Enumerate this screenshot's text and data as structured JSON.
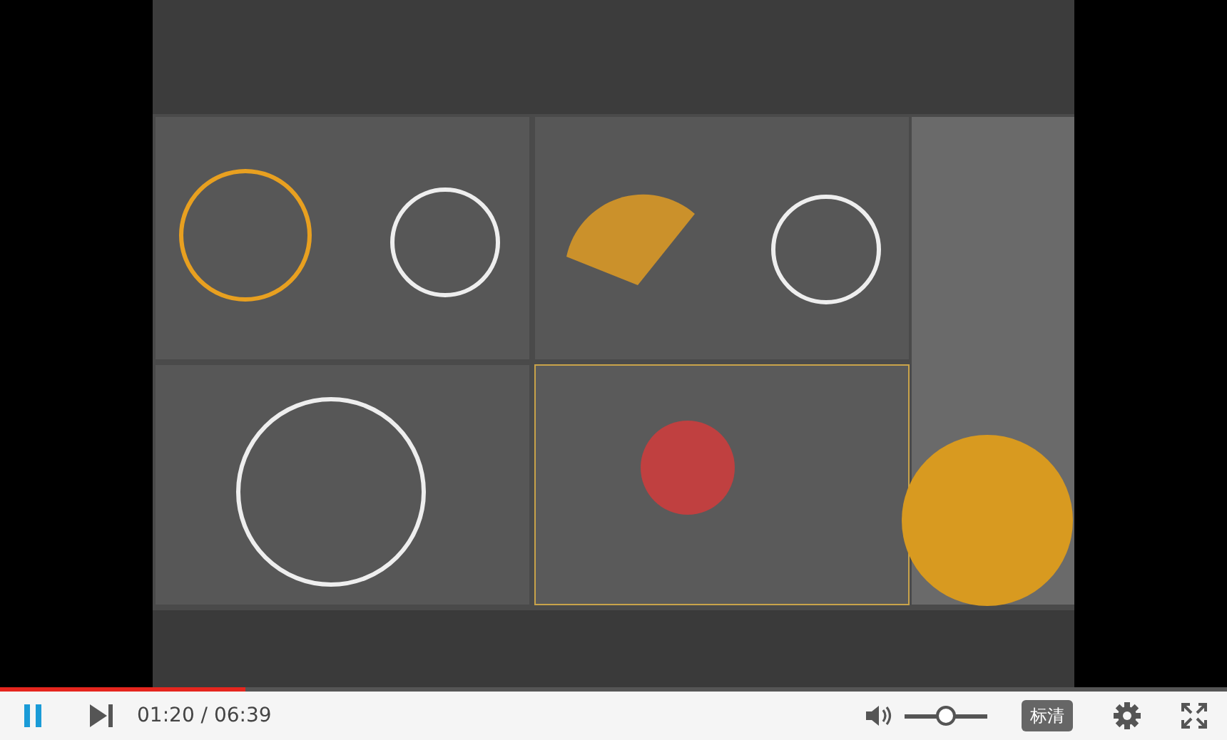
{
  "progress": {
    "level": 0.2
  },
  "controls": {
    "playing": true,
    "time": "01:20 / 06:39",
    "volume": {
      "level": 0.5
    },
    "quality": "标清"
  }
}
